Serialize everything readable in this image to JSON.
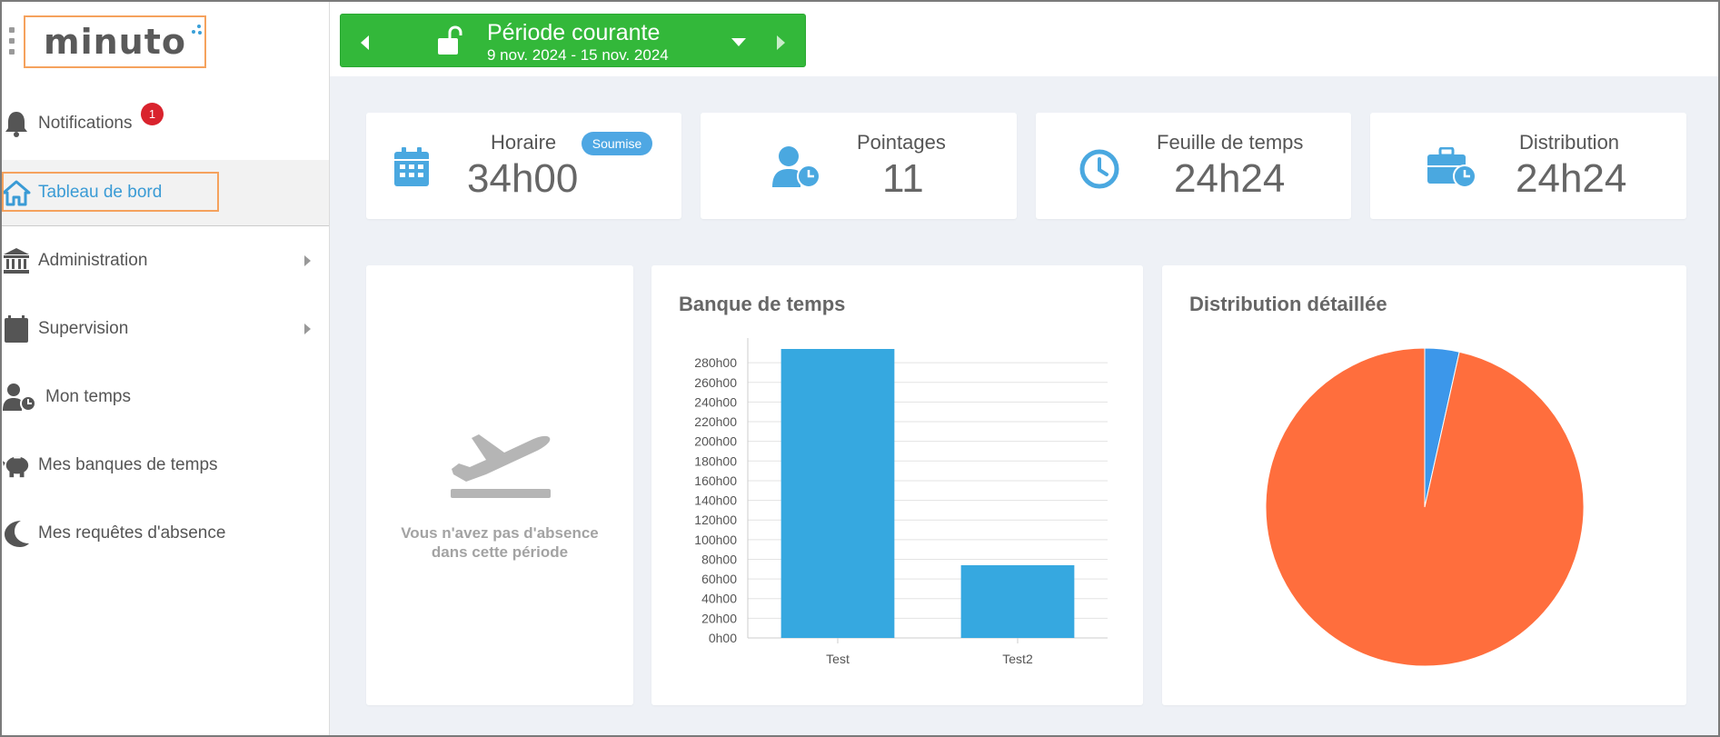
{
  "app": {
    "logo_text": "minuto"
  },
  "sidebar": {
    "items": [
      {
        "label": "Notifications",
        "icon": "bell-icon",
        "badge": "1"
      },
      {
        "label": "Tableau de bord",
        "icon": "home-icon",
        "active": true
      },
      {
        "label": "Administration",
        "icon": "bank-icon",
        "has_submenu": true
      },
      {
        "label": "Supervision",
        "icon": "calendar-icon",
        "has_submenu": true
      },
      {
        "label": "Mon temps",
        "icon": "user-clock-icon"
      },
      {
        "label": "Mes banques de temps",
        "icon": "piggy-bank-icon"
      },
      {
        "label": "Mes requêtes d'absence",
        "icon": "moon-icon"
      }
    ]
  },
  "period": {
    "title": "Période courante",
    "dates": "9 nov. 2024 - 15 nov. 2024",
    "color": "#33b83a"
  },
  "stats": [
    {
      "title": "Horaire",
      "value": "34h00",
      "badge": "Soumise",
      "icon": "calendar-icon"
    },
    {
      "title": "Pointages",
      "value": "11",
      "icon": "user-clock-icon"
    },
    {
      "title": "Feuille de temps",
      "value": "24h24",
      "icon": "clock-icon"
    },
    {
      "title": "Distribution",
      "value": "24h24",
      "icon": "briefcase-clock-icon"
    }
  ],
  "absence": {
    "message_line1": "Vous n'avez pas d'absence",
    "message_line2": "dans cette période"
  },
  "bank_chart": {
    "title": "Banque de temps"
  },
  "distribution_chart": {
    "title": "Distribution détaillée"
  },
  "chart_data": [
    {
      "type": "bar",
      "title": "Banque de temps",
      "categories": [
        "Test",
        "Test2"
      ],
      "values": [
        294,
        74
      ],
      "ylim": [
        0,
        294
      ],
      "yticks": [
        "0h00",
        "20h00",
        "40h00",
        "60h00",
        "80h00",
        "100h00",
        "120h00",
        "140h00",
        "160h00",
        "180h00",
        "200h00",
        "220h00",
        "240h00",
        "260h00",
        "280h00"
      ],
      "ytick_values": [
        0,
        20,
        40,
        60,
        80,
        100,
        120,
        140,
        160,
        180,
        200,
        220,
        240,
        260,
        280
      ],
      "color": "#36a8e0",
      "grid": true
    },
    {
      "type": "pie",
      "title": "Distribution détaillée",
      "slices": [
        {
          "value": 3.5,
          "color": "#3c97ea"
        },
        {
          "value": 96.5,
          "color": "#ff6e3d"
        }
      ]
    }
  ]
}
